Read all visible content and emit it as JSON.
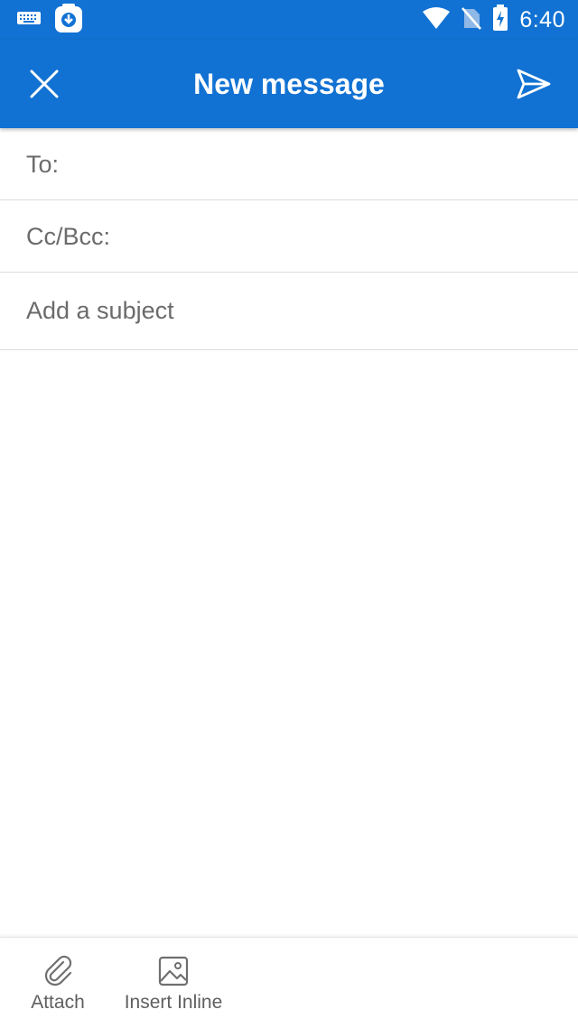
{
  "status_bar": {
    "time": "6:40",
    "icons": [
      "keyboard-icon",
      "download-app-icon",
      "wifi-icon",
      "no-sim-icon",
      "battery-charging-icon"
    ]
  },
  "app_bar": {
    "title": "New message",
    "close_icon": "close-icon",
    "send_icon": "send-icon",
    "background_color": "#1272d3"
  },
  "compose": {
    "to_label": "To:",
    "cc_bcc_label": "Cc/Bcc:",
    "subject_placeholder": "Add a subject",
    "subject_value": ""
  },
  "toolbar": {
    "attach_label": "Attach",
    "attach_icon": "paperclip-icon",
    "insert_inline_label": "Insert Inline",
    "insert_inline_icon": "image-icon"
  }
}
